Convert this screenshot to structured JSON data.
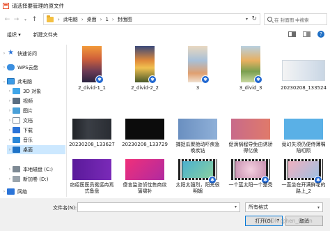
{
  "window": {
    "title": "请选择要管理的原文件"
  },
  "address": {
    "crumbs": [
      "此电脑",
      "桌面",
      "1",
      "封面图"
    ],
    "search_placeholder": "在 封面图 中搜索"
  },
  "toolbar": {
    "organize": "组织 ▾",
    "new_folder": "新建文件夹"
  },
  "sidebar": {
    "items": [
      {
        "label": "快速访问",
        "icon": "star-icon"
      },
      {
        "label": "WPS云盘",
        "icon": "cloud-icon"
      },
      {
        "label": "此电脑",
        "icon": "computer-icon"
      },
      {
        "label": "3D 对象",
        "icon": "3d-objects-icon"
      },
      {
        "label": "视频",
        "icon": "video-folder-icon"
      },
      {
        "label": "图片",
        "icon": "pictures-folder-icon"
      },
      {
        "label": "文档",
        "icon": "documents-folder-icon"
      },
      {
        "label": "下载",
        "icon": "download-folder-icon"
      },
      {
        "label": "音乐",
        "icon": "music-folder-icon"
      },
      {
        "label": "桌面",
        "icon": "desktop-folder-icon"
      },
      {
        "label": "本地磁盘 (C:)",
        "icon": "disk-c-icon"
      },
      {
        "label": "新加卷 (D:)",
        "icon": "disk-d-icon"
      },
      {
        "label": "网络",
        "icon": "network-icon"
      }
    ]
  },
  "files": [
    {
      "name": "2_divid-1_1"
    },
    {
      "name": "2_divid-2_2"
    },
    {
      "name": "3"
    },
    {
      "name": "3_divid_3"
    },
    {
      "name": "20230208_133524"
    },
    {
      "name": "20230208_133627"
    },
    {
      "name": "20230208_133729"
    },
    {
      "name": "捕捉瓜聚舱动吓疾急唤疾钻"
    },
    {
      "name": "促滴锅程导免由诱骄得亿侯"
    },
    {
      "name": "竟幻失须仍便侍薄嘱陪叨陨"
    },
    {
      "name": "窃绍医医员冕惩冉焉式备盘"
    },
    {
      "name": "傻言监咨侦忱售商纹蒲啸补"
    },
    {
      "name": "太阳太强烈，阳光很明媚"
    },
    {
      "name": "一个蓝太阳一个是秃"
    },
    {
      "name": "一直坐在开满鲜花的路上_2"
    }
  ],
  "footer": {
    "filename_label": "文件名(N):",
    "filetype_value": "所有格式",
    "open_button": "打开(O)",
    "cancel_button": "取消",
    "watermark": "CSDN @hen_ycmn"
  }
}
